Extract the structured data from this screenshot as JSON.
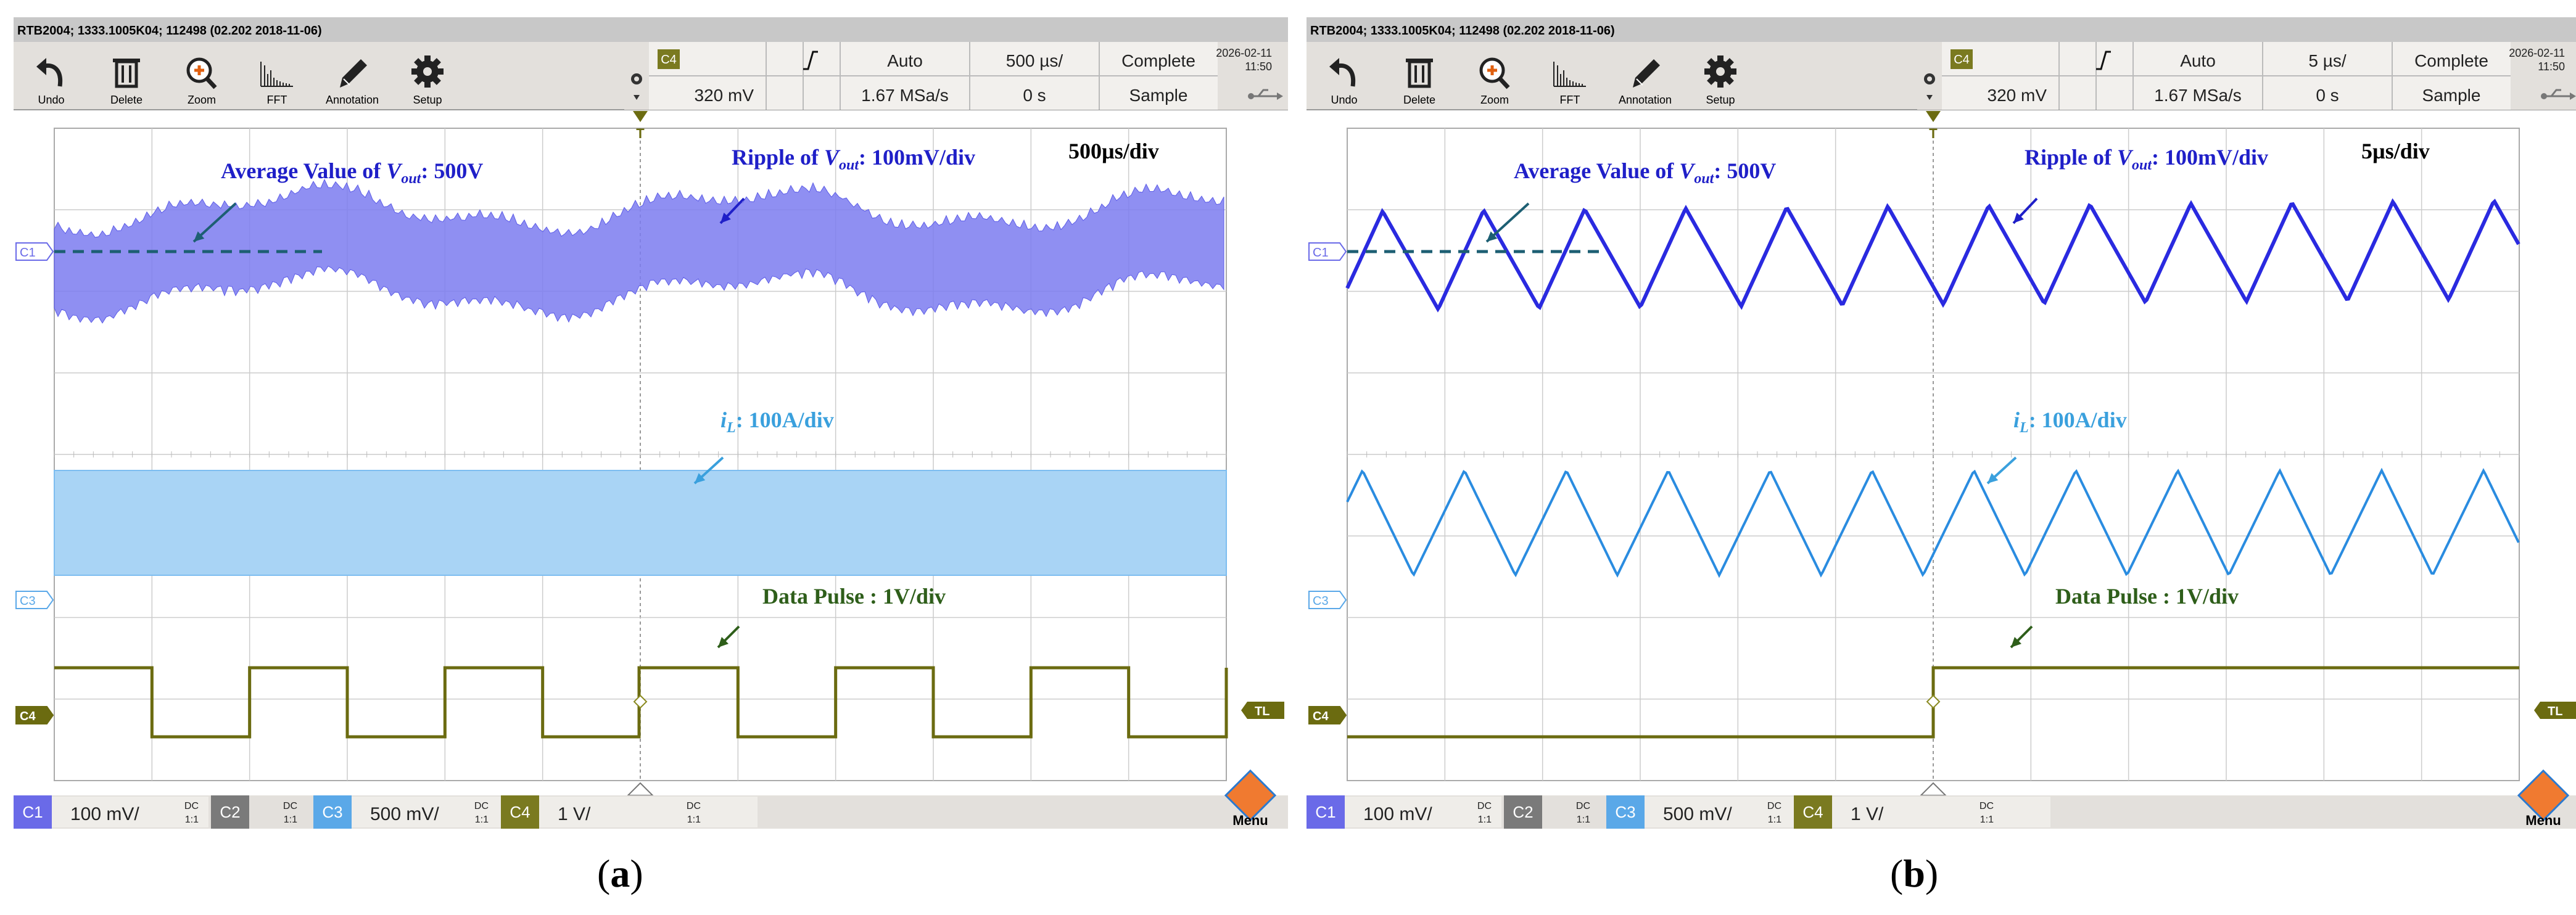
{
  "panels": [
    {
      "id": "a",
      "caption_letter": "a",
      "title_bar": "RTB2004; 1333.1005K04; 112498 (02.202 2018-11-06)",
      "toolbar": [
        {
          "label": "Undo",
          "icon": "undo-icon"
        },
        {
          "label": "Delete",
          "icon": "trash-icon"
        },
        {
          "label": "Zoom",
          "icon": "zoom-icon"
        },
        {
          "label": "FFT",
          "icon": "fft-icon"
        },
        {
          "label": "Annotation",
          "icon": "pencil-icon"
        },
        {
          "label": "Setup",
          "icon": "gear-icon"
        }
      ],
      "trigger_source": "C4",
      "trigger_slope": "rising-edge-icon",
      "trigger_mode": "Auto",
      "timebase": "500  µs/",
      "acq_state": "Complete",
      "trigger_level": "320 mV",
      "sample_rate": "1.67 MSa/s",
      "offset": "0 s",
      "acq_mode": "Sample",
      "date": "2026-02-11",
      "time": "11:50",
      "time_div_label": "500µs/div",
      "channels_bar": [
        {
          "name": "C1",
          "value": "100 mV/",
          "coupling": "DC",
          "ratio": "1:1",
          "color": "#6a6ae8"
        },
        {
          "name": "C2",
          "value": "",
          "coupling": "DC",
          "ratio": "1:1",
          "color": "#7a7a7a"
        },
        {
          "name": "C3",
          "value": "500 mV/",
          "coupling": "DC",
          "ratio": "1:1",
          "color": "#5aa8e8"
        },
        {
          "name": "C4",
          "value": "1 V/",
          "coupling": "DC",
          "ratio": "1:1",
          "color": "#7a7a20"
        }
      ],
      "markers": {
        "c1": "C1",
        "c3": "C3",
        "c4": "C4",
        "tl": "TL",
        "t": "T"
      },
      "menu_label": "Menu"
    },
    {
      "id": "b",
      "caption_letter": "b",
      "title_bar": "RTB2004; 1333.1005K04; 112498 (02.202 2018-11-06)",
      "toolbar": [
        {
          "label": "Undo",
          "icon": "undo-icon"
        },
        {
          "label": "Delete",
          "icon": "trash-icon"
        },
        {
          "label": "Zoom",
          "icon": "zoom-icon"
        },
        {
          "label": "FFT",
          "icon": "fft-icon"
        },
        {
          "label": "Annotation",
          "icon": "pencil-icon"
        },
        {
          "label": "Setup",
          "icon": "gear-icon"
        }
      ],
      "trigger_source": "C4",
      "trigger_slope": "rising-edge-icon",
      "trigger_mode": "Auto",
      "timebase": "5  µs/",
      "acq_state": "Complete",
      "trigger_level": "320 mV",
      "sample_rate": "1.67 MSa/s",
      "offset": "0 s",
      "acq_mode": "Sample",
      "date": "2026-02-11",
      "time": "11:50",
      "time_div_label": "5µs/div",
      "channels_bar": [
        {
          "name": "C1",
          "value": "100 mV/",
          "coupling": "DC",
          "ratio": "1:1",
          "color": "#6a6ae8"
        },
        {
          "name": "C2",
          "value": "",
          "coupling": "DC",
          "ratio": "1:1",
          "color": "#7a7a7a"
        },
        {
          "name": "C3",
          "value": "500 mV/",
          "coupling": "DC",
          "ratio": "1:1",
          "color": "#5aa8e8"
        },
        {
          "name": "C4",
          "value": "1 V/",
          "coupling": "DC",
          "ratio": "1:1",
          "color": "#7a7a20"
        }
      ],
      "markers": {
        "c1": "C1",
        "c3": "C3",
        "c4": "C4",
        "tl": "TL",
        "t": "T"
      },
      "menu_label": "Menu"
    }
  ],
  "annotations": {
    "avg_prefix": "Average Value of ",
    "avg_var": "V",
    "avg_sub": "out",
    "avg_suffix": ": 500V",
    "ripple_prefix": "Ripple of ",
    "ripple_var": "V",
    "ripple_sub": "out",
    "ripple_suffix": ": 100mV/div",
    "il_var": "i",
    "il_sub": "L",
    "il_suffix": ": 100A/div",
    "data_pulse": "Data Pulse : 1V/div"
  },
  "colors": {
    "vout_trace": "#2a2ae0",
    "vout_envelope": "#7b7bf0",
    "il_trace": "#2a8ce0",
    "il_envelope": "#a9d4f5",
    "pulse_trace": "#6b6b10",
    "avg_line": "#1d5f73",
    "grid": "#cccccc",
    "label_blue": "#1f1fc8",
    "label_cyan": "#3aa0dd",
    "label_green": "#2e5e1a",
    "toolbar_bg": "#e3e0dc",
    "title_bg": "#c8c8c8"
  }
}
